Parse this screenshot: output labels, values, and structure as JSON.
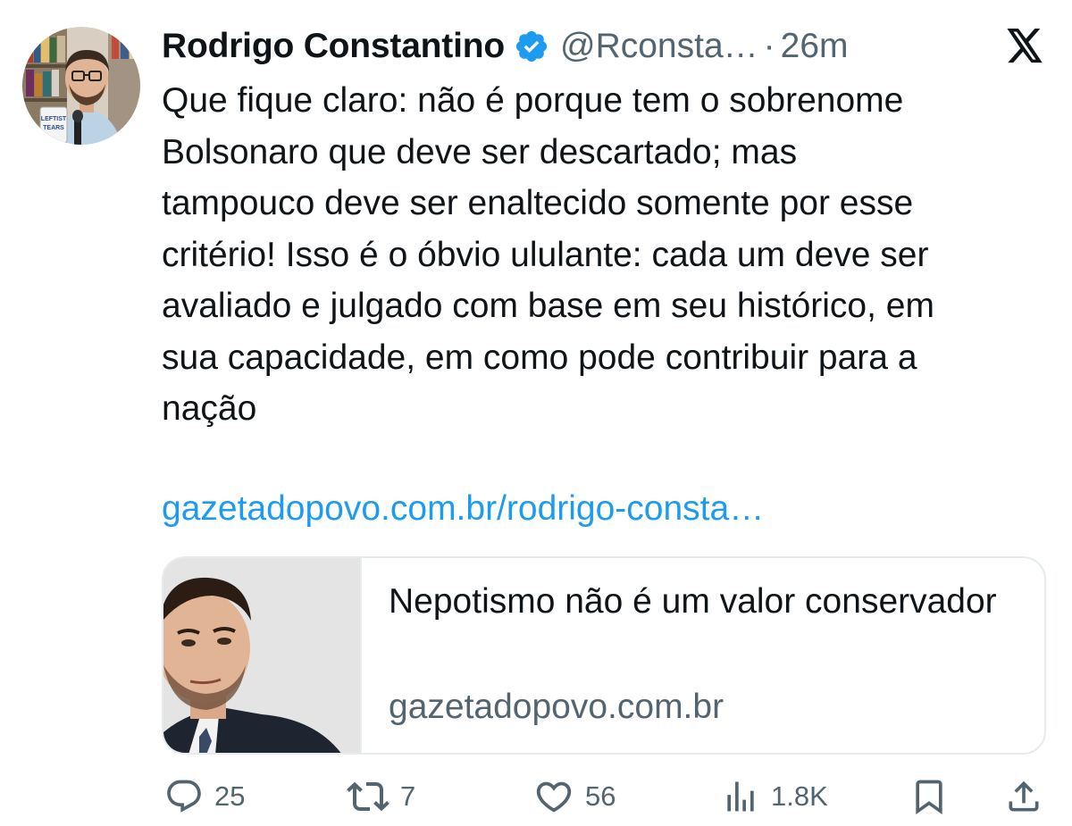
{
  "tweet": {
    "author_name": "Rodrigo Constantino",
    "handle": "@Rconsta…",
    "separator": "·",
    "time": "26m",
    "text_lines": [
      "Que fique claro: não é porque tem o sobrenome",
      "Bolsonaro que deve ser descartado; mas",
      "tampouco deve ser enaltecido somente por esse",
      "critério! Isso é o óbvio ululante: cada um deve ser",
      "avaliado e julgado com base em seu histórico, em",
      "sua capacidade, em como pode contribuir para a",
      "nação"
    ],
    "link": "gazetadopovo.com.br/rodrigo-consta…",
    "avatar_mug_text": [
      "LEFTIST",
      "TEARS"
    ]
  },
  "card": {
    "title": "Nepotismo não é um valor conservador",
    "domain": "gazetadopovo.com.br"
  },
  "actions": {
    "replies": "25",
    "reposts": "7",
    "likes": "56",
    "views": "1.8K"
  },
  "icons": {
    "verified": "verified-badge-icon",
    "logo": "x-logo-icon",
    "reply": "reply-icon",
    "repost": "repost-icon",
    "like": "heart-icon",
    "views": "views-icon",
    "bookmark": "bookmark-icon",
    "share": "share-icon"
  },
  "colors": {
    "text": "#0f1419",
    "secondary": "#536471",
    "link": "#1d9bf0",
    "verified": "#1d9bf0",
    "border": "#e6ebee"
  }
}
